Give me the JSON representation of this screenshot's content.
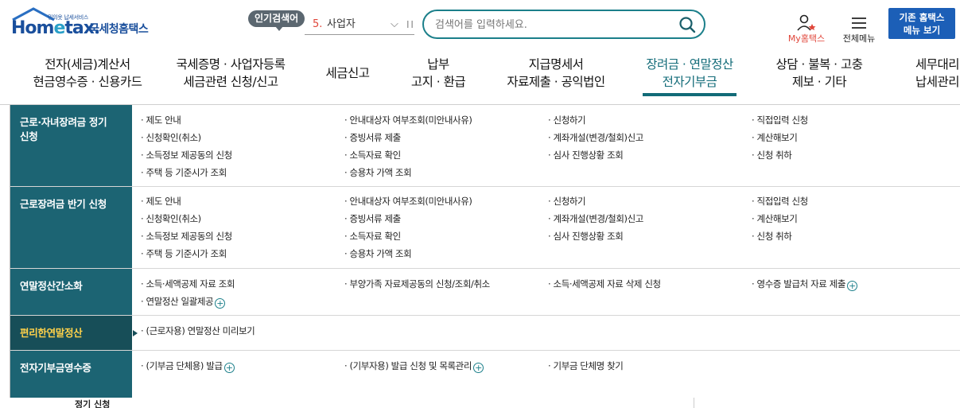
{
  "header": {
    "logo": {
      "wordmark_a": "Hom",
      "wordmark_e": "e",
      "wordmark_b": "tax.",
      "tagline": "민의옷 납세서비스",
      "service_name": "국세청홈택스"
    },
    "popular": {
      "badge": "인기검색어",
      "rank": "5.",
      "keyword": "사업자"
    },
    "search": {
      "placeholder": "검색어를 입력하세요."
    },
    "my_hometax": "My홈택스",
    "all_menu": "전체메뉴",
    "old_hometax": [
      "기존 홈택스",
      "메뉴 보기"
    ]
  },
  "gnb": [
    {
      "line1": "전자(세금)계산서",
      "line2": "현금영수증 · 신용카드"
    },
    {
      "line1": "국세증명 · 사업자등록",
      "line2": "세금관련 신청/신고"
    },
    {
      "line1": "세금신고",
      "line2": ""
    },
    {
      "line1": "납부",
      "line2": "고지 · 환급"
    },
    {
      "line1": "지급명세서",
      "line2": "자료제출 · 공익법인"
    },
    {
      "line1": "장려금 · 연말정산",
      "line2": "전자기부금"
    },
    {
      "line1": "상담 · 불복 · 고충",
      "line2": "제보 · 기타"
    },
    {
      "line1": "세무대리",
      "line2": "납세관리"
    }
  ],
  "panel": [
    {
      "title": [
        "근로·자녀장려금 정기",
        "신청"
      ],
      "items": [
        "· 제도 안내",
        "· 안내대상자 여부조회(미안내사유)",
        "· 신청하기",
        "· 직접입력 신청",
        "· 신청확인(취소)",
        "· 증빙서류 제출",
        "· 계좌개설(변경/철회)신고",
        "· 계산해보기",
        "· 소득정보 제공동의 신청",
        "· 소득자료 확인",
        "· 심사 진행상황 조회",
        "· 신청 취하",
        "· 주택 등 기준시가 조회",
        "· 승용차 가액 조회"
      ]
    },
    {
      "title": [
        "근로장려금 반기 신청"
      ],
      "items": [
        "· 제도 안내",
        "· 안내대상자 여부조회(미안내사유)",
        "· 신청하기",
        "· 직접입력 신청",
        "· 신청확인(취소)",
        "· 증빙서류 제출",
        "· 계좌개설(변경/철회)신고",
        "· 계산해보기",
        "· 소득정보 제공동의 신청",
        "· 소득자료 확인",
        "· 심사 진행상황 조회",
        "· 신청 취하",
        "· 주택 등 기준시가 조회",
        "· 승용차 가액 조회"
      ]
    },
    {
      "title": [
        "연말정산간소화"
      ],
      "items": [
        "· 소득·세액공제 자료 조회",
        "· 부양가족 자료제공동의 신청/조회/취소",
        "· 소득·세액공제 자료 삭제 신청",
        "· 영수증 발급처 자료 제출",
        "· 연말정산 일괄제공"
      ]
    },
    {
      "title": [
        "편리한연말정산"
      ],
      "items": [
        "· (근로자용) 연말정산 미리보기"
      ]
    },
    {
      "title": [
        "전자기부금영수증"
      ],
      "items": [
        "· (기부금 단체용) 발급",
        "· (기부자용) 발급 신청 및 목록관리",
        "· 기부금 단체명 찾기"
      ]
    }
  ],
  "footer": {
    "text": "정기 신청"
  }
}
